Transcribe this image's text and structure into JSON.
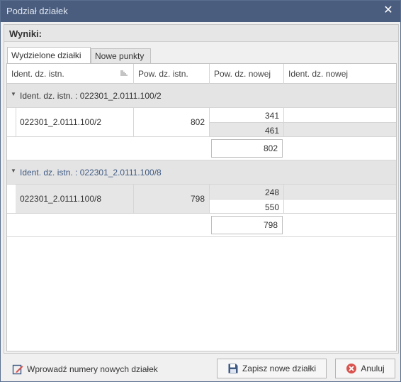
{
  "window": {
    "title": "Podział działek",
    "close_glyph": "✕"
  },
  "panel": {
    "title": "Wyniki:"
  },
  "tabs": [
    {
      "label": "Wydzielone działki",
      "active": true
    },
    {
      "label": "Nowe punkty",
      "active": false
    }
  ],
  "columns": [
    "Ident. dz. istn.",
    "Pow. dz. istn.",
    "Pow. dz. nowej",
    "Ident. dz. nowej"
  ],
  "groups": [
    {
      "header": "Ident. dz. istn. : 022301_2.0111.100/2",
      "ident": "022301_2.0111.100/2",
      "area": "802",
      "new_areas": [
        "341",
        "461"
      ],
      "sum": "802"
    },
    {
      "header": "Ident. dz. istn. : 022301_2.0111.100/8",
      "ident": "022301_2.0111.100/8",
      "area": "798",
      "new_areas": [
        "248",
        "550"
      ],
      "sum": "798"
    }
  ],
  "footer": {
    "enter_numbers_label": "Wprowadź numery nowych działek",
    "save_label": "Zapisz nowe działki",
    "cancel_label": "Anuluj"
  },
  "icons": {
    "sort": "sort-icon",
    "collapse": "chevron-down-icon",
    "edit": "edit-icon",
    "save": "floppy-icon",
    "cancel": "cancel-icon"
  },
  "colors": {
    "titlebar": "#4a5d7e",
    "group_bg": "#e4e4e4",
    "accent_blue": "#3f5a83",
    "cancel_red": "#d9534f"
  }
}
